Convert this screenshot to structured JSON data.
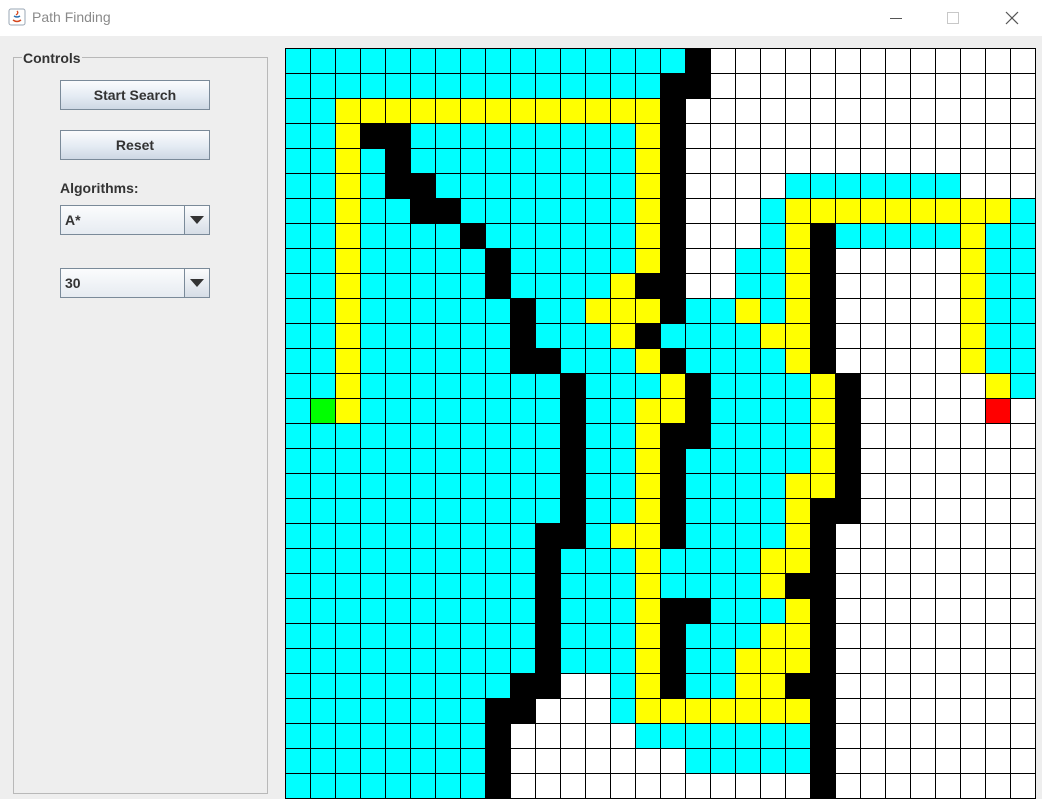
{
  "window": {
    "title": "Path Finding"
  },
  "controls": {
    "legend": "Controls",
    "start_label": "Start Search",
    "reset_label": "Reset",
    "algorithms_label": "Algorithms:",
    "algorithm_selected": "A*",
    "size_selected": "30"
  },
  "grid": {
    "colors": {
      "w": "#ffffff",
      "c": "#00ffff",
      "y": "#ffff00",
      "b": "#000000",
      "s": "#00ff00",
      "e": "#ff0000"
    },
    "cols": 30,
    "rows": [
      "ccccccccccccccccbwwwwwwwwwwwww",
      "cccccccccccccccbbwwwwwwwwwwwww",
      "ccyyyyyyyyyyyyybwwwwwwwwwwwwww",
      "ccybbcccccccccybwwwwwwwwwwwwww",
      "ccycbcccccccccybwwwwwwwwwwwwww",
      "ccycbbccccccccybwwwwcccccccwww",
      "ccyccbbcccccccybwwwcyyyyyyyyyc",
      "ccyccccbccccccybwwwcybcccccycc",
      "ccycccccbcccccybwwccybwwwwwycc",
      "ccycccccbccccybbwwccybwwwwwycc",
      "ccyccccccbccyyybccycybwwwwwycc",
      "ccyccccccbcccybccccyybwwwwwycc",
      "ccyccccccbbcccybccccybwwwwwycc",
      "ccyccccccccbcccybccccybwwwwwycc",
      "csyccccccccbccyybccccybwwwwwew",
      "cccccccccccbccybbccccybwwwwwww",
      "cccccccccccbccybcccccybwwwwwww",
      "cccccccccccbccybccccyybwwwwwww",
      "cccccccccccbccybccccybbwwwwwww",
      "ccccccccccbbcyybccccybwwwwwwww",
      "ccccccccccbcccyccccyybwwwwwwww",
      "ccccccccccbcccyccccybbwwwwwwww",
      "ccccccccccbcccybbcccybwwwwwwww",
      "ccccccccccbcccybcccyybwwwwwwww",
      "ccccccccccbcccybccyyybwwwwwwww",
      "cccccccccbbwwcybccyybbwwwwwwww",
      "ccccccccbbwwwcyyyyyyybwwwwwwww",
      "ccccccccbwwwwwcccccccbwwwwwwww",
      "ccccccccbwwwwwwwcccccbwwwwwwww",
      "ccccccccbwwwwwwwwwwwwbwwwwwwww"
    ]
  }
}
